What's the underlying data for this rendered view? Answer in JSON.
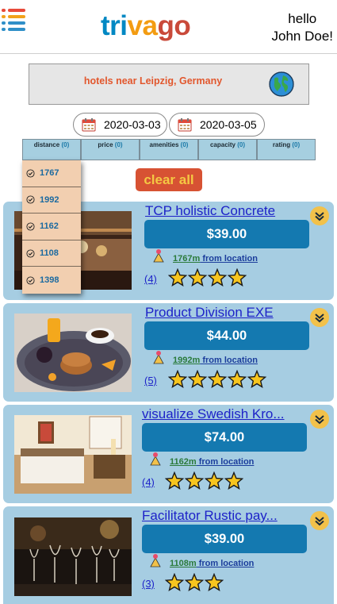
{
  "header": {
    "logo": {
      "part1": "tri",
      "part2": "va",
      "part3": "go"
    },
    "greeting_line1": "hello",
    "greeting_line2": "John Doe!"
  },
  "search": {
    "text": "hotels near Leipzig, Germany"
  },
  "dates": {
    "checkin": "2020-03-03",
    "checkout": "2020-03-05"
  },
  "filters": [
    {
      "label": "distance",
      "count": "(0)"
    },
    {
      "label": "price",
      "count": "(0)"
    },
    {
      "label": "amenities",
      "count": "(0)"
    },
    {
      "label": "capacity",
      "count": "(0)"
    },
    {
      "label": "rating",
      "count": "(0)"
    }
  ],
  "distance_options": [
    "1767",
    "1992",
    "1162",
    "1108",
    "1398"
  ],
  "clear_all_label": "clear all",
  "hotels": [
    {
      "name": "TCP holistic Concrete",
      "price": "$39.00",
      "distance": "1767m",
      "from_label": " from location",
      "reviews": "(4)",
      "stars": 4
    },
    {
      "name": "Product Division EXE",
      "price": "$44.00",
      "distance": "1992m",
      "from_label": " from location",
      "reviews": "(5)",
      "stars": 5
    },
    {
      "name": "visualize Swedish Kro...",
      "price": "$74.00",
      "distance": "1162m",
      "from_label": " from location",
      "reviews": "(4)",
      "stars": 4
    },
    {
      "name": "Facilitator Rustic pay...",
      "price": "$39.00",
      "distance": "1108m",
      "from_label": " from location",
      "reviews": "(3)",
      "stars": 3
    }
  ],
  "colors": {
    "brand_blue": "#0088c3",
    "brand_orange": "#f39c12",
    "brand_red": "#c94a3a",
    "card_bg": "#a6cde2",
    "price_bg": "#1479b0",
    "clear_bg": "#d75233",
    "star": "#f7c51e"
  },
  "icons": {
    "menu": "hamburger-menu-icon",
    "globe": "globe-icon",
    "calendar": "calendar-icon",
    "check": "check-circle-icon",
    "chevron": "chevron-down-icon",
    "pin": "map-pin-icon",
    "star": "star-icon"
  }
}
